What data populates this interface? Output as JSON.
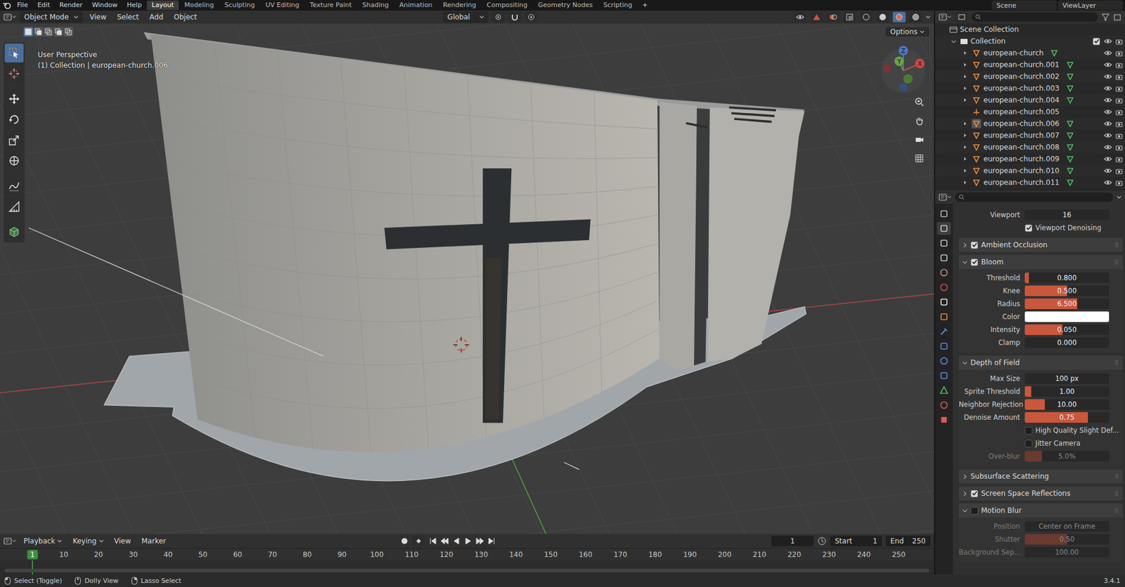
{
  "topbar": {
    "menus": [
      "File",
      "Edit",
      "Render",
      "Window",
      "Help"
    ],
    "workspaces": [
      {
        "label": "Layout",
        "selected": true
      },
      {
        "label": "Modeling",
        "selected": false
      },
      {
        "label": "Sculpting",
        "selected": false
      },
      {
        "label": "UV Editing",
        "selected": false
      },
      {
        "label": "Texture Paint",
        "selected": false
      },
      {
        "label": "Shading",
        "selected": false
      },
      {
        "label": "Animation",
        "selected": false
      },
      {
        "label": "Rendering",
        "selected": false
      },
      {
        "label": "Compositing",
        "selected": false
      },
      {
        "label": "Geometry Nodes",
        "selected": false
      },
      {
        "label": "Scripting",
        "selected": false
      }
    ],
    "add_tab": "+",
    "scene": "Scene",
    "view_layer": "ViewLayer"
  },
  "viewport_header": {
    "mode": "Object Mode",
    "menus": [
      "View",
      "Select",
      "Add",
      "Object"
    ],
    "orientation": "Global",
    "options": "Options",
    "shading": [
      {
        "selected": false
      },
      {
        "selected": false
      },
      {
        "selected": true
      },
      {
        "selected": false
      }
    ],
    "select_modes": [
      {
        "selected": true
      },
      {
        "selected": false
      },
      {
        "selected": false
      },
      {
        "selected": false
      },
      {
        "selected": false
      }
    ]
  },
  "viewport": {
    "perspective": "User Perspective",
    "context": "(1) Collection | european-church.006",
    "gizmo": {
      "x": "X",
      "y": "Y",
      "z": "Z"
    }
  },
  "tools": [
    {
      "kind": "select-box",
      "selected": true
    },
    {
      "kind": "cursor",
      "selected": false
    },
    {
      "kind": "move",
      "selected": false
    },
    {
      "kind": "rotate",
      "selected": false
    },
    {
      "kind": "scale",
      "selected": false
    },
    {
      "kind": "transform",
      "selected": false
    },
    {
      "kind": "annotate",
      "selected": false
    },
    {
      "kind": "measure",
      "selected": false
    },
    {
      "kind": "add-cube",
      "selected": false
    }
  ],
  "outliner": {
    "root": "Scene Collection",
    "collection": {
      "label": "Collection",
      "checked": true
    },
    "items": [
      {
        "label": "european-church",
        "kind": "mesh",
        "selected": false
      },
      {
        "label": "european-church.001",
        "kind": "mesh",
        "selected": false
      },
      {
        "label": "european-church.002",
        "kind": "mesh",
        "selected": false
      },
      {
        "label": "european-church.003",
        "kind": "mesh",
        "selected": false
      },
      {
        "label": "european-church.004",
        "kind": "mesh",
        "selected": false
      },
      {
        "label": "european-church.005",
        "kind": "empty",
        "selected": false
      },
      {
        "label": "european-church.006",
        "kind": "mesh",
        "selected": true
      },
      {
        "label": "european-church.007",
        "kind": "mesh",
        "selected": false
      },
      {
        "label": "european-church.008",
        "kind": "mesh",
        "selected": false
      },
      {
        "label": "european-church.009",
        "kind": "mesh",
        "selected": false
      },
      {
        "label": "european-church.010",
        "kind": "mesh",
        "selected": false
      },
      {
        "label": "european-church.011",
        "kind": "mesh",
        "selected": false
      }
    ]
  },
  "property_tabs": [
    {
      "kind": "tool",
      "selected": false
    },
    {
      "kind": "render",
      "selected": true
    },
    {
      "kind": "output",
      "selected": false
    },
    {
      "kind": "view-layer",
      "selected": false
    },
    {
      "kind": "scene",
      "selected": false
    },
    {
      "kind": "world",
      "selected": false
    },
    {
      "kind": "collection",
      "selected": false
    },
    {
      "kind": "object",
      "selected": false
    },
    {
      "kind": "modifier",
      "selected": false
    },
    {
      "kind": "particles",
      "selected": false
    },
    {
      "kind": "physics",
      "selected": false
    },
    {
      "kind": "constraints",
      "selected": false
    },
    {
      "kind": "data",
      "selected": false
    },
    {
      "kind": "material",
      "selected": false
    },
    {
      "kind": "texture",
      "selected": false
    }
  ],
  "properties": {
    "top_row": {
      "label": "Viewport",
      "value": "16"
    },
    "denoise": {
      "label": "Viewport Denoising",
      "checked": true
    },
    "sections": [
      {
        "title": "Ambient Occlusion",
        "has_checkbox": true,
        "checked": true,
        "expanded": false,
        "rows": []
      },
      {
        "title": "Bloom",
        "has_checkbox": true,
        "checked": true,
        "expanded": true,
        "rows": [
          {
            "kind": "slider",
            "label": "Threshold",
            "value": "0.800",
            "level": 0.05,
            "disabled": false
          },
          {
            "kind": "slider",
            "label": "Knee",
            "value": "0.500",
            "level": 0.5,
            "disabled": false
          },
          {
            "kind": "slider",
            "label": "Radius",
            "value": "6.500",
            "level": 0.62,
            "disabled": false
          },
          {
            "kind": "color",
            "label": "Color",
            "color": "#ffffff"
          },
          {
            "kind": "slider",
            "label": "Intensity",
            "value": "0.050",
            "level": 0.45,
            "disabled": false
          },
          {
            "kind": "slider",
            "label": "Clamp",
            "value": "0.000",
            "level": 0,
            "disabled": false
          }
        ]
      },
      {
        "title": "Depth of Field",
        "has_checkbox": false,
        "expanded": true,
        "rows": [
          {
            "kind": "field",
            "label": "Max Size",
            "value": "100 px",
            "disabled": false
          },
          {
            "kind": "slider",
            "label": "Sprite Threshold",
            "value": "1.00",
            "level": 0.08,
            "disabled": false
          },
          {
            "kind": "slider",
            "label": "Neighbor Rejection",
            "value": "10.00",
            "level": 0.24,
            "disabled": false
          },
          {
            "kind": "slider",
            "label": "Denoise Amount",
            "value": "0.75",
            "level": 0.75,
            "disabled": false
          },
          {
            "kind": "check",
            "label": "High Quality Slight Def...",
            "checked": false
          },
          {
            "kind": "check",
            "label": "Jitter Camera",
            "checked": false
          },
          {
            "kind": "slider",
            "label": "Over-blur",
            "value": "5.0%",
            "level": 0.2,
            "disabled": true
          }
        ]
      },
      {
        "title": "Subsurface Scattering",
        "has_checkbox": false,
        "expanded": false,
        "rows": []
      },
      {
        "title": "Screen Space Reflections",
        "has_checkbox": true,
        "checked": true,
        "expanded": false,
        "rows": []
      },
      {
        "title": "Motion Blur",
        "has_checkbox": true,
        "checked": false,
        "expanded": true,
        "rows": [
          {
            "kind": "field",
            "label": "Position",
            "value": "Center on Frame",
            "disabled": true
          },
          {
            "kind": "slider",
            "label": "Shutter",
            "value": "0.50",
            "level": 0.5,
            "disabled": true
          },
          {
            "kind": "field",
            "label": "Background Sep...",
            "value": "100.00",
            "disabled": true
          }
        ]
      }
    ]
  },
  "timeline": {
    "menus": [
      "Playback",
      "Keying",
      "View",
      "Marker"
    ],
    "current_frame": "1",
    "start_label": "Start",
    "start": "1",
    "end_label": "End",
    "end": "250",
    "ruler": [
      {
        "label": "1",
        "selected": true
      },
      {
        "label": "10",
        "selected": false
      },
      {
        "label": "20",
        "selected": false
      },
      {
        "label": "30",
        "selected": false
      },
      {
        "label": "40",
        "selected": false
      },
      {
        "label": "50",
        "selected": false
      },
      {
        "label": "60",
        "selected": false
      },
      {
        "label": "70",
        "selected": false
      },
      {
        "label": "80",
        "selected": false
      },
      {
        "label": "90",
        "selected": false
      },
      {
        "label": "100",
        "selected": false
      },
      {
        "label": "110",
        "selected": false
      },
      {
        "label": "120",
        "selected": false
      },
      {
        "label": "130",
        "selected": false
      },
      {
        "label": "140",
        "selected": false
      },
      {
        "label": "150",
        "selected": false
      },
      {
        "label": "160",
        "selected": false
      },
      {
        "label": "170",
        "selected": false
      },
      {
        "label": "180",
        "selected": false
      },
      {
        "label": "190",
        "selected": false
      },
      {
        "label": "200",
        "selected": false
      },
      {
        "label": "210",
        "selected": false
      },
      {
        "label": "220",
        "selected": false
      },
      {
        "label": "230",
        "selected": false
      },
      {
        "label": "240",
        "selected": false
      },
      {
        "label": "250",
        "selected": false
      }
    ]
  },
  "status_bar": {
    "items": [
      {
        "label": "Select (Toggle)",
        "kind": "mouse-left"
      },
      {
        "label": "Dolly View",
        "kind": "mouse-middle"
      },
      {
        "label": "Lasso Select",
        "kind": "mouse-right"
      }
    ],
    "version": "3.4.1"
  }
}
